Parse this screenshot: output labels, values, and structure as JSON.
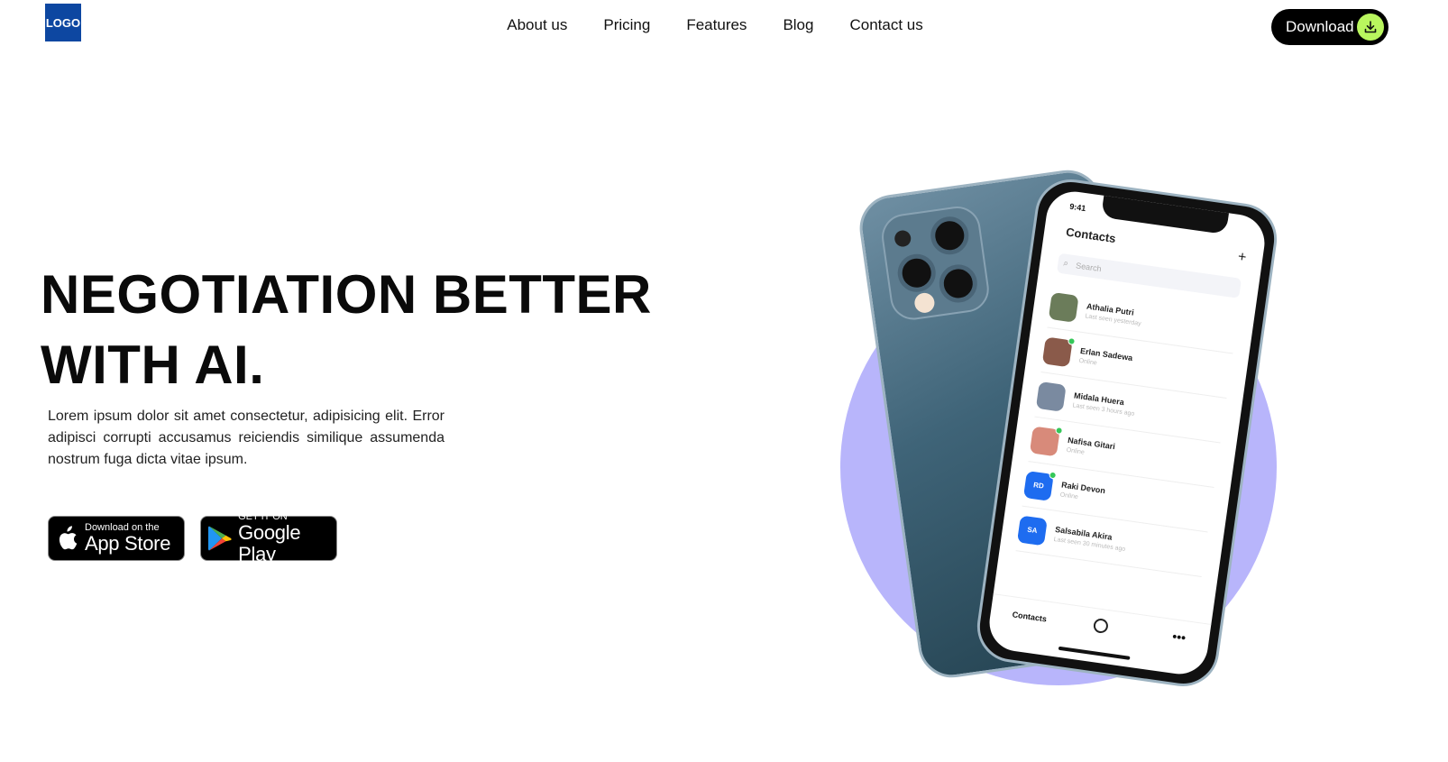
{
  "header": {
    "logo_text": "LOGO",
    "nav": [
      "About us",
      "Pricing",
      "Features",
      "Blog",
      "Contact us"
    ],
    "download_label": "Download",
    "accent_color": "#b9f65e"
  },
  "hero": {
    "title_line1": "NEGOTIATION BETTER",
    "title_line2": "WITH AI.",
    "body": "Lorem ipsum dolor sit amet consectetur, adipisicing elit. Error adipisci corrupti accusamus reiciendis similique assumenda nostrum fuga dicta vitae ipsum.",
    "app_store": {
      "small": "Download on the",
      "big": "App Store"
    },
    "google_play": {
      "small": "GET IT ON",
      "big": "Google Play"
    }
  },
  "phone": {
    "time": "9:41",
    "screen_title": "Contacts",
    "search_placeholder": "Search",
    "contacts": [
      {
        "name": "Athalia Putri",
        "status": "Last seen yesterday",
        "online": false,
        "initials": "",
        "color": "#6b7c5a"
      },
      {
        "name": "Erlan Sadewa",
        "status": "Online",
        "online": true,
        "initials": "",
        "color": "#8a5a4a"
      },
      {
        "name": "Midala Huera",
        "status": "Last seen 3 hours ago",
        "online": false,
        "initials": "",
        "color": "#7a8aa0"
      },
      {
        "name": "Nafisa Gitari",
        "status": "Online",
        "online": true,
        "initials": "",
        "color": "#d88a7a"
      },
      {
        "name": "Raki Devon",
        "status": "Online",
        "online": true,
        "initials": "RD",
        "color": "#1e6cf0"
      },
      {
        "name": "Salsabila Akira",
        "status": "Last seen 30 minutes ago",
        "online": false,
        "initials": "SA",
        "color": "#1e6cf0"
      }
    ],
    "tab_label": "Contacts",
    "circle_color": "#b8b5fb"
  }
}
